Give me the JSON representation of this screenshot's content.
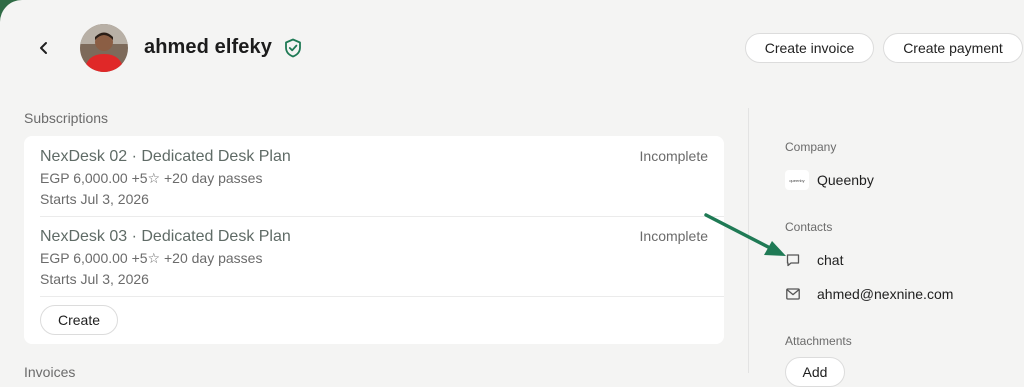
{
  "header": {
    "name": "ahmed elfeky",
    "create_invoice": "Create invoice",
    "create_payment": "Create payment"
  },
  "subscriptions": {
    "title": "Subscriptions",
    "items": [
      {
        "title": "NexDesk 02 · Dedicated Desk Plan",
        "price": "EGP 6,000.00 +5☆ +20 day passes",
        "starts": "Starts Jul 3, 2026",
        "status": "Incomplete"
      },
      {
        "title": "NexDesk 03 · Dedicated Desk Plan",
        "price": "EGP 6,000.00 +5☆ +20 day passes",
        "starts": "Starts Jul 3, 2026",
        "status": "Incomplete"
      }
    ],
    "create_label": "Create"
  },
  "next_section": {
    "title": "Invoices"
  },
  "sidebar": {
    "company_label": "Company",
    "company_name": "Queenby",
    "company_logo_text": "queenby",
    "contacts_label": "Contacts",
    "chat": "chat",
    "email": "ahmed@nexnine.com",
    "attachments_label": "Attachments",
    "add_label": "Add"
  },
  "colors": {
    "accent_green": "#1f7a55",
    "background": "#f4f4f3"
  }
}
